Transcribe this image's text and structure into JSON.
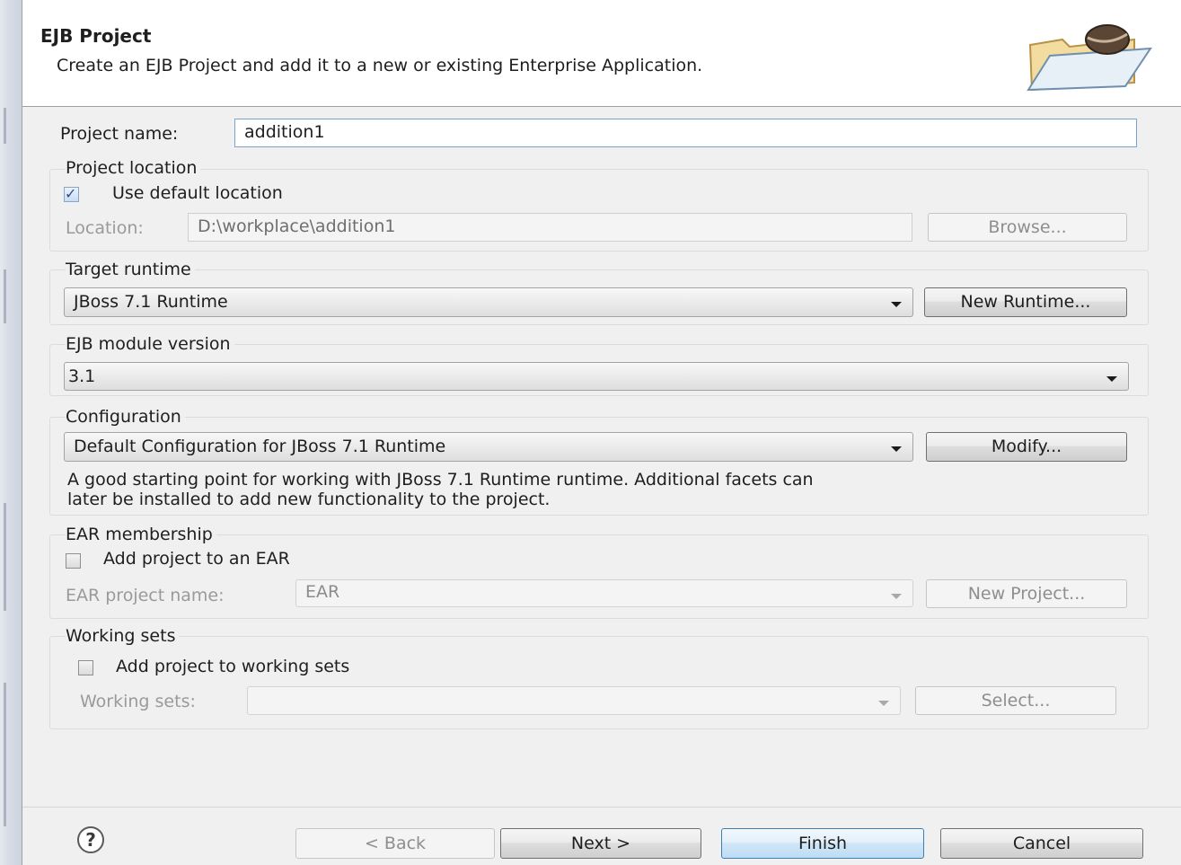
{
  "header": {
    "title": "EJB Project",
    "description": "Create an EJB Project and add it to a new or existing Enterprise Application."
  },
  "project": {
    "name_label": "Project name:",
    "name_value": "addition1"
  },
  "location": {
    "group_title": "Project location",
    "use_default_label": "Use default location",
    "use_default_checked": true,
    "location_label": "Location:",
    "location_value": "D:\\workplace\\addition1",
    "browse_label": "Browse..."
  },
  "runtime": {
    "group_title": "Target runtime",
    "selected": "JBoss 7.1 Runtime",
    "new_runtime_label": "New Runtime..."
  },
  "module_version": {
    "group_title": "EJB module version",
    "selected": "3.1"
  },
  "configuration": {
    "group_title": "Configuration",
    "selected": "Default Configuration for JBoss 7.1 Runtime",
    "modify_label": "Modify...",
    "description_line1": "A good starting point for working with JBoss 7.1 Runtime runtime. Additional facets can",
    "description_line2": "later be installed to add new functionality to the project."
  },
  "ear": {
    "group_title": "EAR membership",
    "add_label": "Add project to an EAR",
    "add_checked": false,
    "project_name_label": "EAR project name:",
    "project_name_value": "EAR",
    "new_project_label": "New Project..."
  },
  "working_sets": {
    "group_title": "Working sets",
    "add_label": "Add project to working sets",
    "add_checked": false,
    "sets_label": "Working sets:",
    "sets_value": "",
    "select_label": "Select..."
  },
  "footer": {
    "help_glyph": "?",
    "back_label": "< Back",
    "next_label": "Next >",
    "finish_label": "Finish",
    "cancel_label": "Cancel"
  },
  "icons": {
    "header_icon": "folder-with-bean-icon",
    "help_icon": "help-icon"
  }
}
